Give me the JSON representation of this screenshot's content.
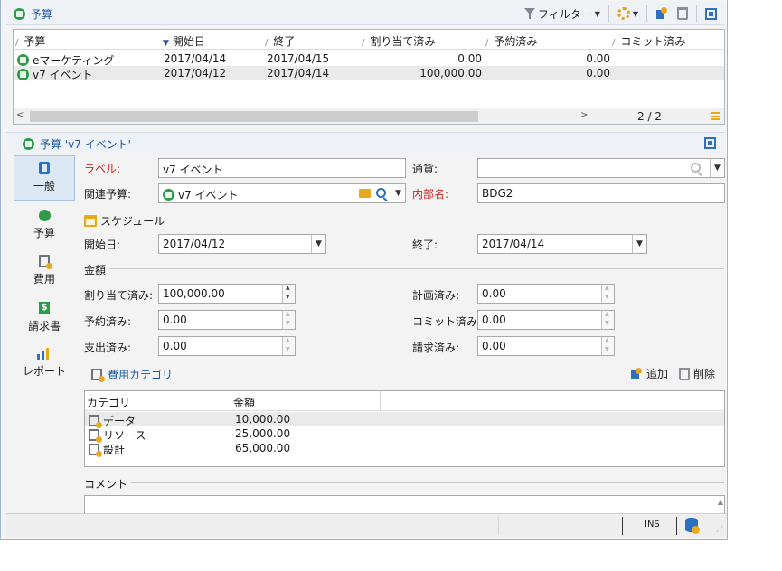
{
  "top_panel": {
    "title": "予算",
    "toolbar": {
      "filter_label": "フィルター"
    }
  },
  "grid": {
    "columns": [
      "予算",
      "開始日",
      "終了",
      "割り当て済み",
      "予約済み",
      "コミット済み"
    ],
    "rows": [
      {
        "name": "eマーケティング",
        "start": "2017/04/14",
        "end": "2017/04/15",
        "allocated": "0.00",
        "reserved": "0.00"
      },
      {
        "name": "v7 イベント",
        "start": "2017/04/12",
        "end": "2017/04/14",
        "allocated": "100,000.00",
        "reserved": "0.00"
      }
    ],
    "page_count": "2 / 2"
  },
  "detail": {
    "title": "予算 'v7 イベント'",
    "sidebar": [
      {
        "label": "一般",
        "icon": "clipboard-icon"
      },
      {
        "label": "予算",
        "icon": "budget-icon"
      },
      {
        "label": "費用",
        "icon": "expense-icon"
      },
      {
        "label": "請求書",
        "icon": "invoice-icon"
      },
      {
        "label": "レポート",
        "icon": "report-icon"
      }
    ],
    "form": {
      "label_label": "ラベル:",
      "label_value": "v7 イベント",
      "currency_label": "通貨:",
      "currency_value": "",
      "parent_label": "関連予算:",
      "parent_value": "v7 イベント",
      "internal_label": "内部名:",
      "internal_value": "BDG2",
      "schedule_section": "スケジュール",
      "start_label": "開始日:",
      "start_value": "2017/04/12",
      "end_label": "終了:",
      "end_value": "2017/04/14",
      "amount_section": "金額",
      "allocated_label": "割り当て済み:",
      "allocated_value": "100,000.00",
      "planned_label": "計画済み:",
      "planned_value": "0.00",
      "reserved_label": "予約済み:",
      "reserved_value": "0.00",
      "committed_label": "コミット済み:",
      "committed_value": "0.00",
      "spent_label": "支出済み:",
      "spent_value": "0.00",
      "invoiced_label": "請求済み:",
      "invoiced_value": "0.00"
    },
    "categories": {
      "title": "費用カテゴリ",
      "add_label": "追加",
      "delete_label": "削除",
      "columns": [
        "カテゴリ",
        "金額"
      ],
      "rows": [
        {
          "name": "データ",
          "amount": "10,000.00"
        },
        {
          "name": "リソース",
          "amount": "25,000.00"
        },
        {
          "name": "設計",
          "amount": "65,000.00"
        }
      ]
    },
    "comment_section": "コメント"
  },
  "status_bar": {
    "mode": "INS"
  }
}
